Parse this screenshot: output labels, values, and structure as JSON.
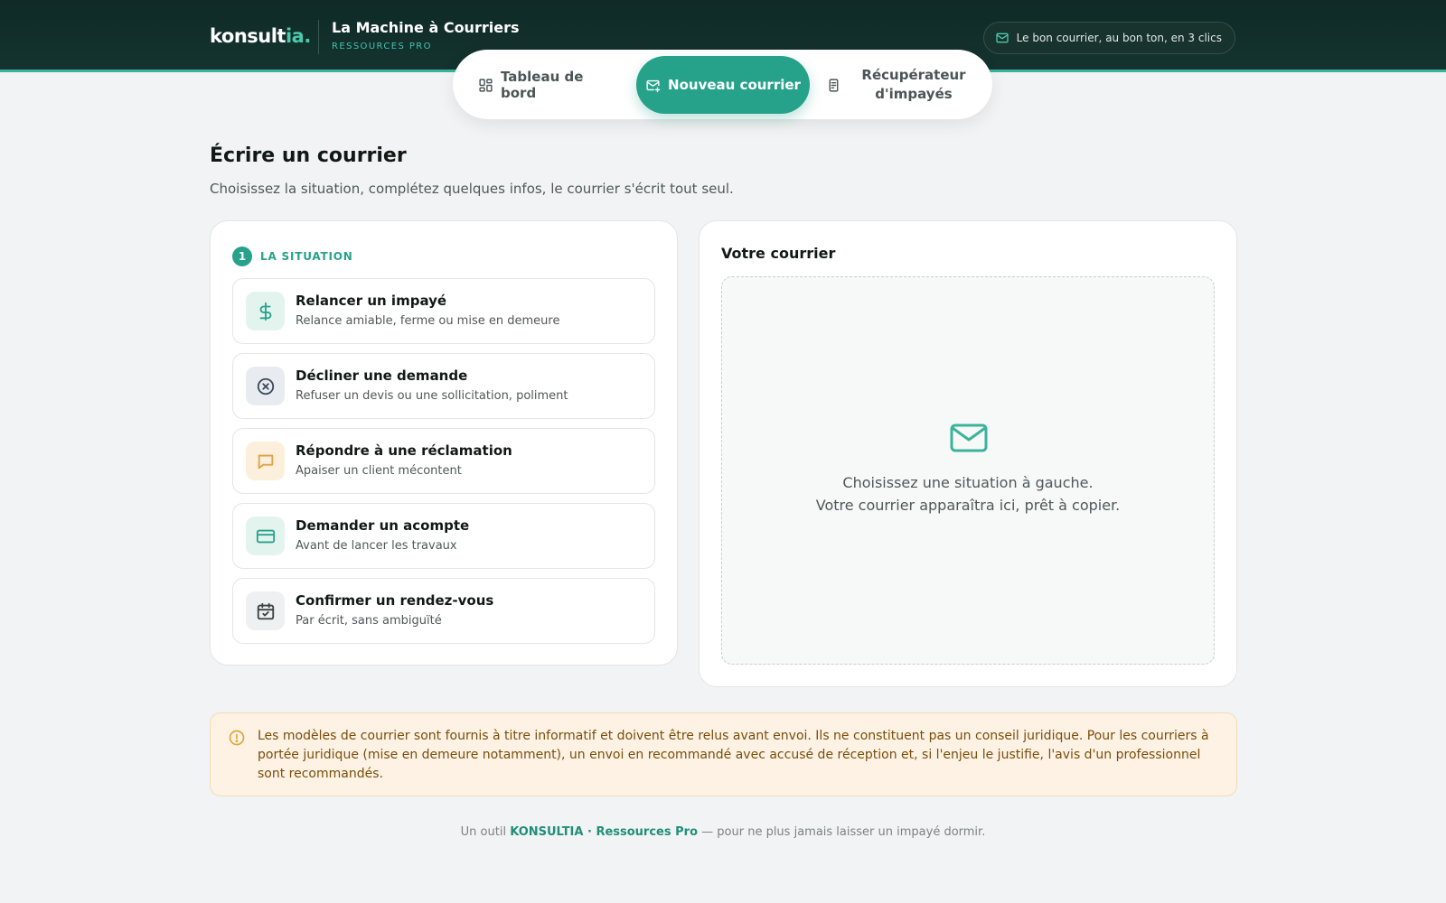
{
  "header": {
    "brand_main": "konsult",
    "brand_accent": "ia.",
    "app_title": "La Machine à Courriers",
    "app_subtitle": "RESSOURCES PRO",
    "tagline": "Le bon courrier, au bon ton, en 3 clics"
  },
  "tabs": [
    {
      "label": "Tableau de bord",
      "icon": "grid-icon",
      "active": false
    },
    {
      "label": "Nouveau courrier",
      "icon": "mail-icon",
      "active": true
    },
    {
      "label": "Récupérateur d'impayés",
      "icon": "document-icon",
      "active": false
    }
  ],
  "page": {
    "title": "Écrire un courrier",
    "subtitle": "Choisissez la situation, complétez quelques infos, le courrier s'écrit tout seul."
  },
  "situation": {
    "step_number": "1",
    "step_label": "LA SITUATION",
    "options": [
      {
        "title": "Relancer un impayé",
        "desc": "Relance amiable, ferme ou mise en demeure",
        "icon": "dollar-icon"
      },
      {
        "title": "Décliner une demande",
        "desc": "Refuser un devis ou une sollicitation, poliment",
        "icon": "x-circle-icon"
      },
      {
        "title": "Répondre à une réclamation",
        "desc": "Apaiser un client mécontent",
        "icon": "chat-icon"
      },
      {
        "title": "Demander un acompte",
        "desc": "Avant de lancer les travaux",
        "icon": "card-icon"
      },
      {
        "title": "Confirmer un rendez-vous",
        "desc": "Par écrit, sans ambiguïté",
        "icon": "calendar-check-icon"
      }
    ]
  },
  "preview": {
    "title": "Votre courrier",
    "empty_line1": "Choisissez une situation à gauche.",
    "empty_line2": "Votre courrier apparaîtra ici, prêt à copier."
  },
  "notice": {
    "text": "Les modèles de courrier sont fournis à titre informatif et doivent être relus avant envoi. Ils ne constituent pas un conseil juridique. Pour les courriers à portée juridique (mise en demeure notamment), un envoi en recommandé avec accusé de réception et, si l'enjeu le justifie, l'avis d'un professionnel sont recommandés."
  },
  "footer": {
    "prefix": "Un outil ",
    "strong": "KONSULTIA · Ressources Pro",
    "suffix": " — pour ne plus jamais laisser un impayé dormir."
  },
  "colors": {
    "header_bg": "#0f2a27",
    "accent": "#27a28a",
    "notice_bg": "#fdf2e3",
    "notice_text": "#7a4e0c"
  }
}
